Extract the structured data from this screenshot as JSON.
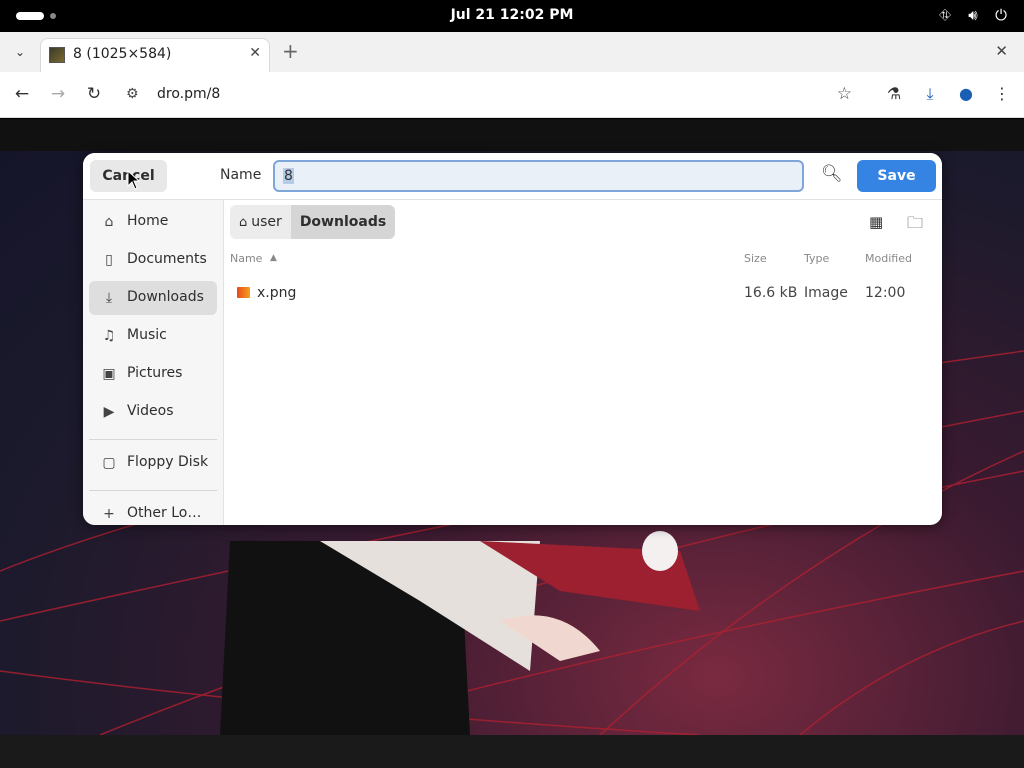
{
  "system_bar": {
    "clock": "Jul 21  12:02 PM",
    "icons": [
      "network-icon",
      "volume-icon",
      "power-icon"
    ]
  },
  "browser": {
    "tab_title": "8 (1025×584)",
    "url": "dro.pm/8"
  },
  "dialog": {
    "cancel_label": "Cancel",
    "name_label": "Name",
    "name_value": "8",
    "save_label": "Save",
    "sidebar": {
      "items": [
        {
          "label": "Home",
          "icon": "home-icon"
        },
        {
          "label": "Documents",
          "icon": "document-icon"
        },
        {
          "label": "Downloads",
          "icon": "download-icon",
          "active": true
        },
        {
          "label": "Music",
          "icon": "music-icon"
        },
        {
          "label": "Pictures",
          "icon": "picture-icon"
        },
        {
          "label": "Videos",
          "icon": "video-icon"
        },
        {
          "label": "Floppy Disk",
          "icon": "drive-icon"
        },
        {
          "label": "Other Lo…",
          "icon": "plus-icon"
        }
      ]
    },
    "path": [
      "user",
      "Downloads"
    ],
    "columns": {
      "name": "Name",
      "size": "Size",
      "type": "Type",
      "modified": "Modified"
    },
    "files": [
      {
        "name": "x.png",
        "size": "16.6 kB",
        "type": "Image",
        "modified": "12:00"
      }
    ]
  },
  "colors": {
    "accent": "#3584e4",
    "input_border": "#7ea6d8"
  }
}
